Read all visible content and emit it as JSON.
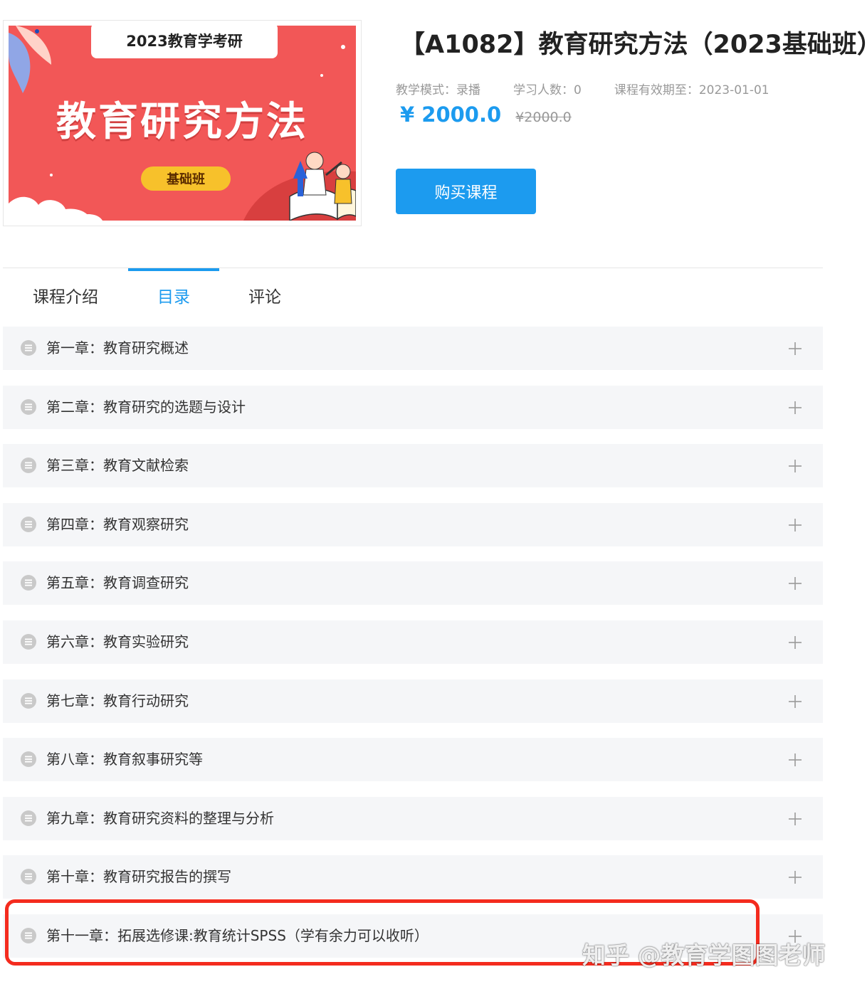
{
  "cover": {
    "top_label": "2023教育学考研",
    "title": "教育研究方法",
    "badge": "基础班",
    "colors": {
      "background": "#f25757",
      "badge": "#f7c12b"
    }
  },
  "course": {
    "title": "【A1082】教育研究方法（2023基础班）",
    "meta": {
      "mode": "教学模式：录播",
      "students": "学习人数：0",
      "expiry": "课程有效期至：2023-01-01"
    },
    "price": "¥ 2000.0",
    "original_price": "¥2000.0",
    "buy_label": "购买课程"
  },
  "tabs": [
    {
      "label": "课程介绍",
      "active": false
    },
    {
      "label": "目录",
      "active": true
    },
    {
      "label": "评论",
      "active": false
    }
  ],
  "chapters": [
    {
      "label": "第一章：教育研究概述",
      "icon": "list-circle-icon",
      "action_icon": "plus-icon"
    },
    {
      "label": "第二章：教育研究的选题与设计",
      "icon": "list-circle-icon",
      "action_icon": "plus-icon"
    },
    {
      "label": "第三章：教育文献检索",
      "icon": "list-circle-icon",
      "action_icon": "plus-icon"
    },
    {
      "label": "第四章：教育观察研究",
      "icon": "list-circle-icon",
      "action_icon": "plus-icon"
    },
    {
      "label": "第五章：教育调查研究",
      "icon": "list-circle-icon",
      "action_icon": "plus-icon"
    },
    {
      "label": "第六章：教育实验研究",
      "icon": "list-circle-icon",
      "action_icon": "plus-icon"
    },
    {
      "label": "第七章：教育行动研究",
      "icon": "list-circle-icon",
      "action_icon": "plus-icon"
    },
    {
      "label": "第八章：教育叙事研究等",
      "icon": "list-circle-icon",
      "action_icon": "plus-icon"
    },
    {
      "label": "第九章：教育研究资料的整理与分析",
      "icon": "list-circle-icon",
      "action_icon": "plus-icon"
    },
    {
      "label": "第十章：教育研究报告的撰写",
      "icon": "list-circle-icon",
      "action_icon": "plus-icon"
    },
    {
      "label": "第十一章：拓展选修课:教育统计SPSS（学有余力可以收听）",
      "icon": "list-circle-icon",
      "action_icon": "plus-icon",
      "highlighted": true
    }
  ],
  "watermark": "知乎 @教育学图图老师",
  "colors": {
    "accent": "#1c9bef",
    "highlight": "#f42b1e",
    "row_background": "#f5f6f8"
  }
}
